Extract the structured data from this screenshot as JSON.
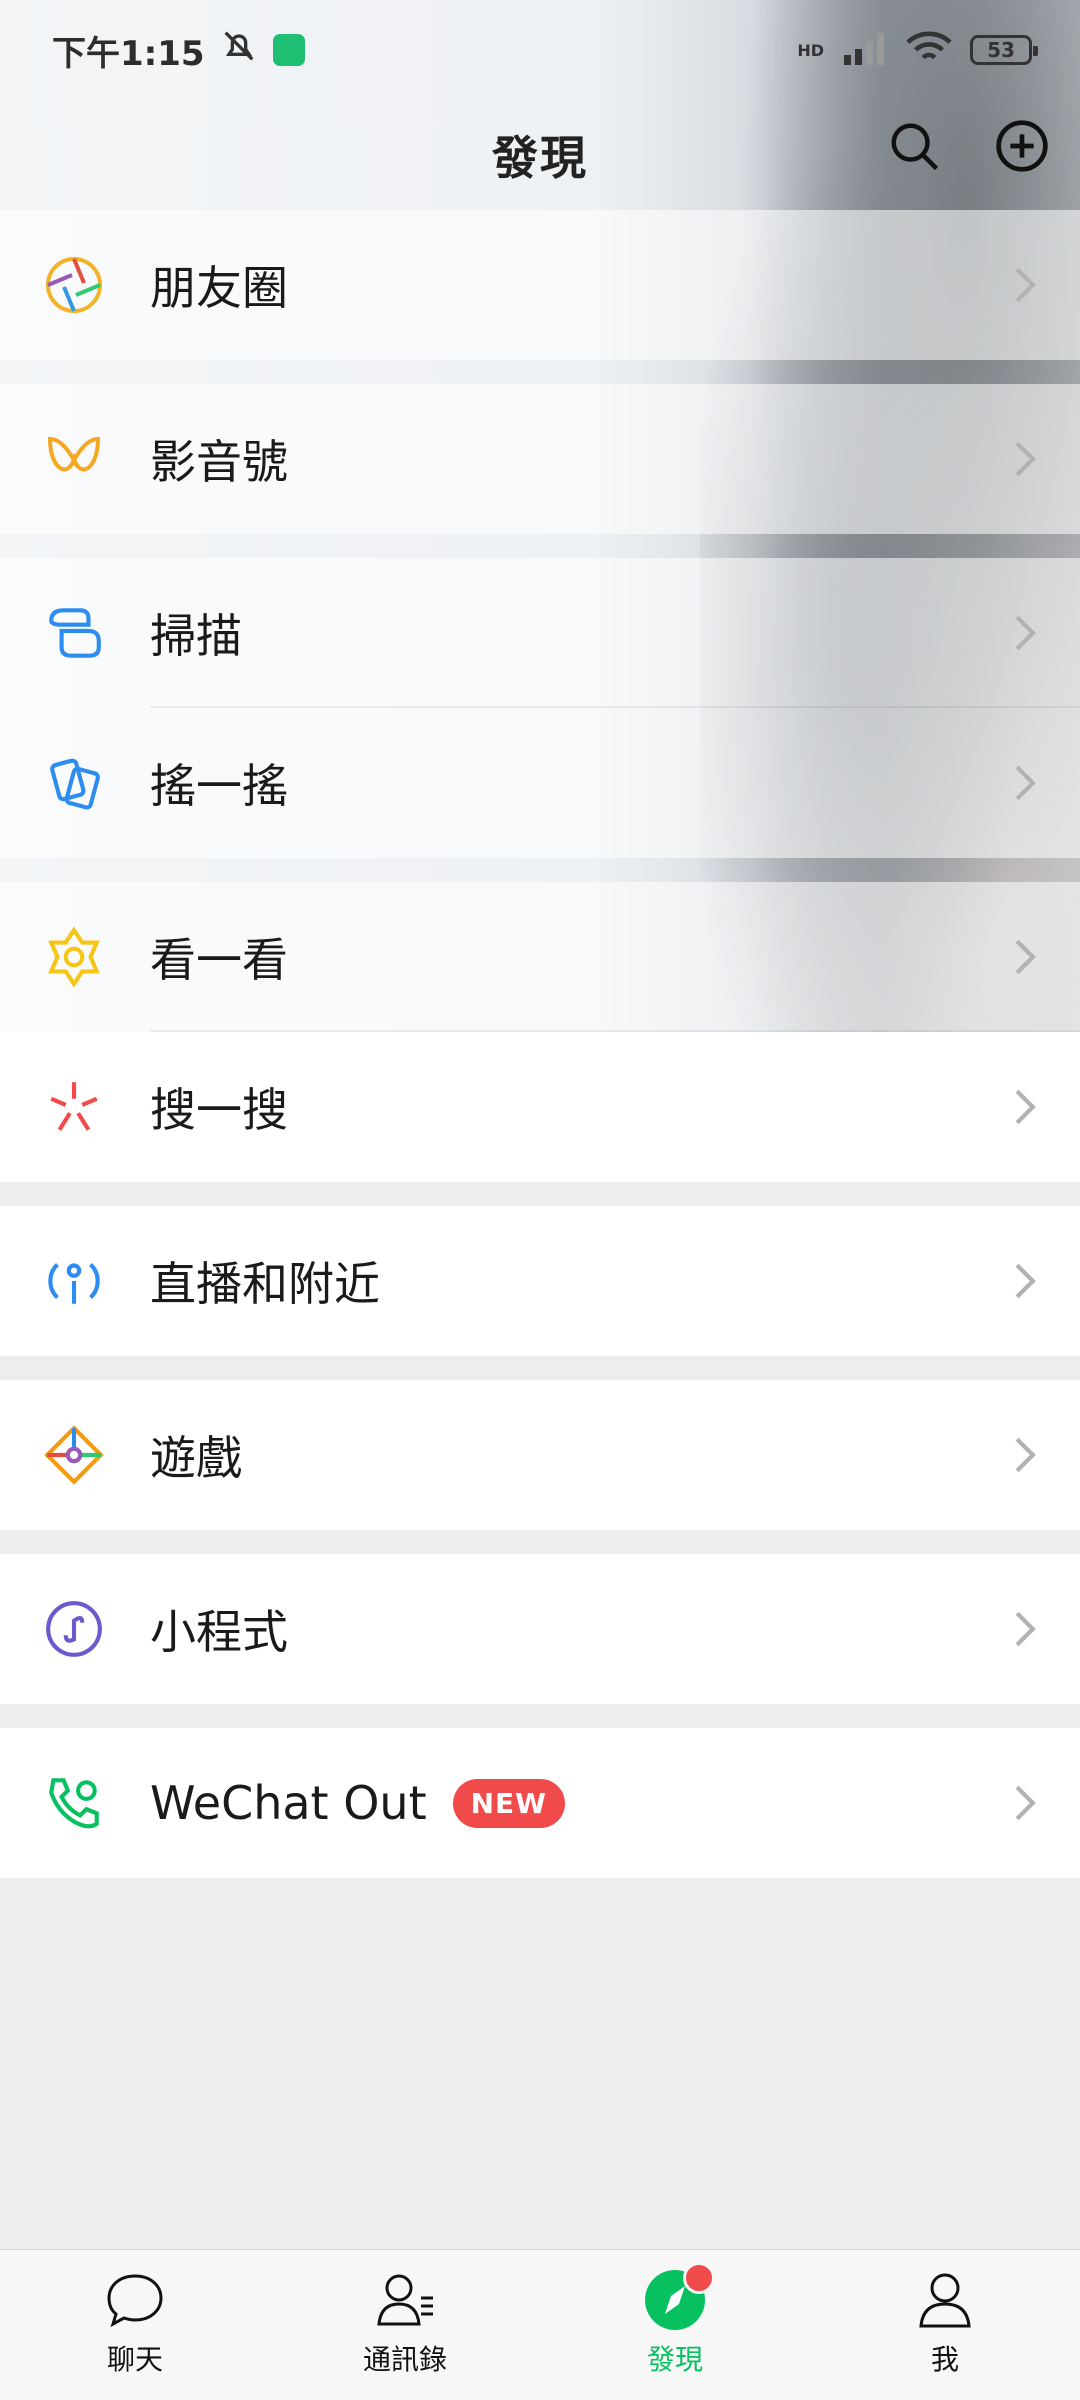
{
  "status_bar": {
    "time": "下午1:15",
    "battery": "53",
    "network": "HD"
  },
  "header": {
    "title": "發現",
    "search_icon": "search-icon",
    "add_icon": "plus-circle-icon"
  },
  "sections": [
    {
      "items": [
        {
          "label": "朋友圈",
          "icon": "moments-icon"
        }
      ]
    },
    {
      "items": [
        {
          "label": "影音號",
          "icon": "channels-icon"
        }
      ]
    },
    {
      "items": [
        {
          "label": "掃描",
          "icon": "scan-icon"
        },
        {
          "label": "搖一搖",
          "icon": "shake-icon"
        }
      ]
    },
    {
      "items": [
        {
          "label": "看一看",
          "icon": "top-stories-icon"
        },
        {
          "label": "搜一搜",
          "icon": "search-spark-icon"
        }
      ]
    },
    {
      "items": [
        {
          "label": "直播和附近",
          "icon": "nearby-icon"
        }
      ]
    },
    {
      "items": [
        {
          "label": "遊戲",
          "icon": "games-icon"
        }
      ]
    },
    {
      "items": [
        {
          "label": "小程式",
          "icon": "mini-programs-icon"
        }
      ]
    },
    {
      "items": [
        {
          "label": "WeChat Out",
          "icon": "phone-icon",
          "badge": "NEW"
        }
      ]
    }
  ],
  "bottom_nav": [
    {
      "label": "聊天",
      "icon": "chat-icon"
    },
    {
      "label": "通訊錄",
      "icon": "contacts-icon"
    },
    {
      "label": "發現",
      "icon": "discover-icon",
      "active": true
    },
    {
      "label": "我",
      "icon": "me-icon"
    }
  ],
  "colors": {
    "accent": "#07c160",
    "badge": "#f04a4a",
    "background": "#ededed"
  }
}
